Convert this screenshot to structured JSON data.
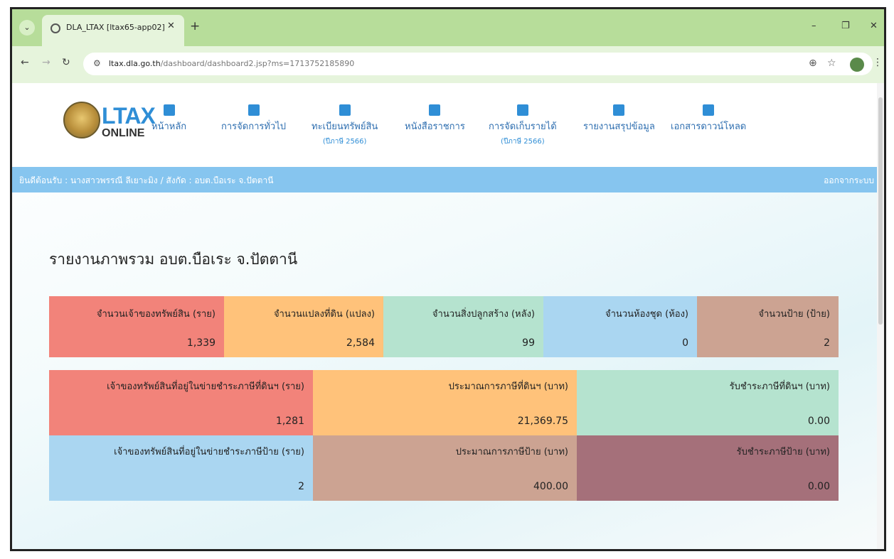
{
  "browser": {
    "tab_title": "DLA_LTAX [ltax65-app02]",
    "url_host": "ltax.dla.go.th",
    "url_path": "/dashboard/dashboard2.jsp?ms=1713752185890"
  },
  "site": {
    "logo_line1": "LTAX",
    "logo_line2": "ONLINE",
    "nav": [
      {
        "label": "หน้าหลัก",
        "sub": ""
      },
      {
        "label": "การจัดการทั่วไป",
        "sub": ""
      },
      {
        "label": "ทะเบียนทรัพย์สิน",
        "sub": "(ปีภาษี 2566)"
      },
      {
        "label": "หนังสือราชการ",
        "sub": ""
      },
      {
        "label": "การจัดเก็บรายได้",
        "sub": "(ปีภาษี 2566)"
      },
      {
        "label": "รายงานสรุปข้อมูล",
        "sub": ""
      },
      {
        "label": "เอกสารดาวน์โหลด",
        "sub": ""
      }
    ],
    "welcome": "ยินดีต้อนรับ : นางสาวพรรณี ลีเยาะมิง / สังกัด : อบต.บือเระ จ.ปัตตานี",
    "logout": "ออกจากระบบ"
  },
  "page_title": "รายงานภาพรวม อบต.บือเระ จ.ปัตตานี",
  "stats_row1": [
    {
      "label": "จำนวนเจ้าของทรัพย์สิน (ราย)",
      "value": "1,339",
      "color": "#f2837a"
    },
    {
      "label": "จำนวนแปลงที่ดิน (แปลง)",
      "value": "2,584",
      "color": "#ffc27a"
    },
    {
      "label": "จำนวนสิ่งปลูกสร้าง (หลัง)",
      "value": "99",
      "color": "#b5e3cf"
    },
    {
      "label": "จำนวนห้องชุด (ห้อง)",
      "value": "0",
      "color": "#aad6f1"
    },
    {
      "label": "จำนวนป้าย (ป้าย)",
      "value": "2",
      "color": "#cca392"
    }
  ],
  "stats_row2": [
    {
      "label": "เจ้าของทรัพย์สินที่อยู่ในข่ายชำระภาษีที่ดินฯ (ราย)",
      "value": "1,281",
      "color": "#f2837a"
    },
    {
      "label": "ประมาณการภาษีที่ดินฯ (บาท)",
      "value": "21,369.75",
      "color": "#ffc27a"
    },
    {
      "label": "รับชำระภาษีที่ดินฯ (บาท)",
      "value": "0.00",
      "color": "#b5e3cf"
    }
  ],
  "stats_row3": [
    {
      "label": "เจ้าของทรัพย์สินที่อยู่ในข่ายชำระภาษีป้าย (ราย)",
      "value": "2",
      "color": "#aad6f1"
    },
    {
      "label": "ประมาณการภาษีป้าย (บาท)",
      "value": "400.00",
      "color": "#cca392"
    },
    {
      "label": "รับชำระภาษีป้าย (บาท)",
      "value": "0.00",
      "color": "#a5707a"
    }
  ]
}
